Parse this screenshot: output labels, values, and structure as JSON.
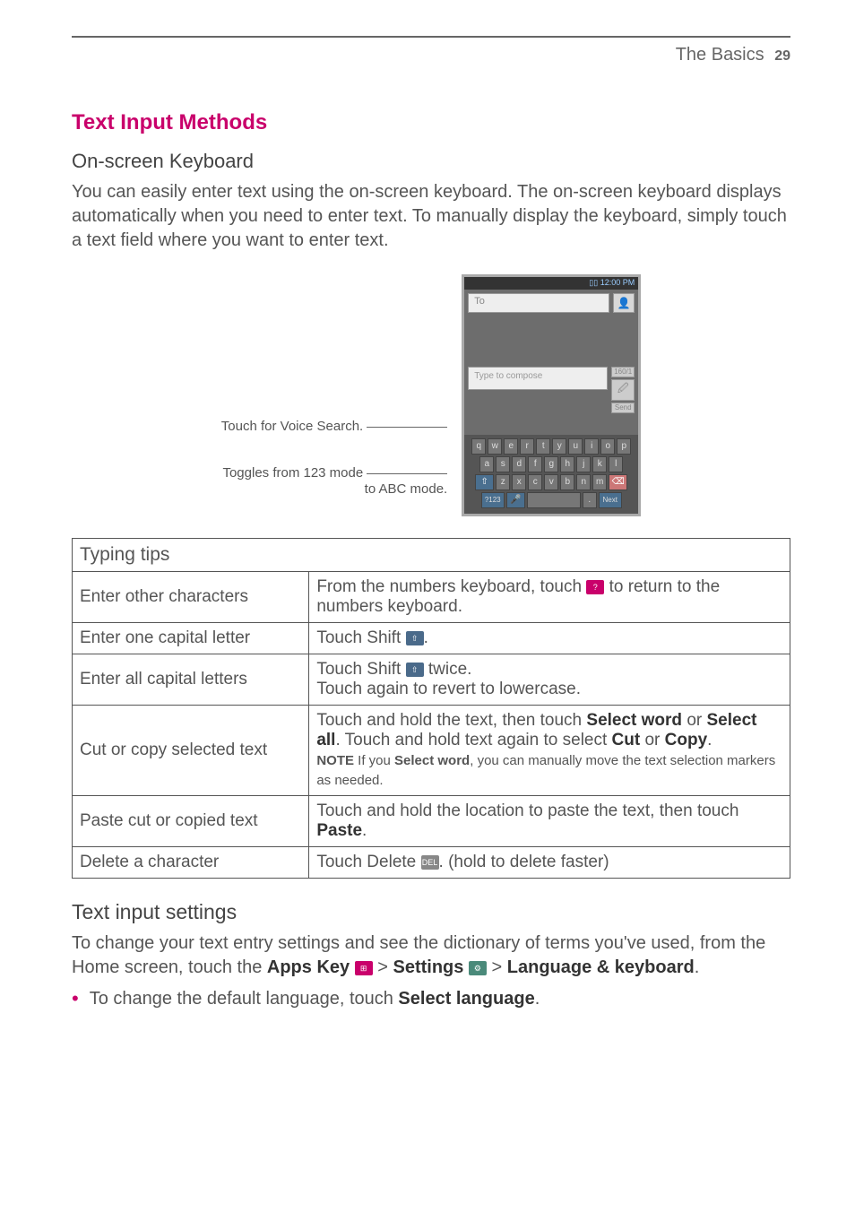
{
  "header": {
    "title": "The Basics",
    "page_num": "29"
  },
  "section": {
    "title": "Text Input Methods"
  },
  "onscreen_kb": {
    "heading": "On-screen Keyboard",
    "body": "You can easily enter text using the on-screen keyboard. The on-screen keyboard displays automatically when you need to enter text. To manually display the keyboard, simply touch a text field where you want to enter text."
  },
  "callouts": {
    "voice": "Touch for Voice Search.",
    "toggle_l1": "Toggles from 123 mode",
    "toggle_l2": "to ABC mode."
  },
  "phone": {
    "status_time": "12:00 PM",
    "to_placeholder": "To",
    "compose_placeholder": "Type to compose",
    "send_label": "Send",
    "count_label": "160/1",
    "row1": [
      "q",
      "w",
      "e",
      "r",
      "t",
      "y",
      "u",
      "i",
      "o",
      "p"
    ],
    "row2": [
      "a",
      "s",
      "d",
      "f",
      "g",
      "h",
      "j",
      "k",
      "l"
    ],
    "row3": [
      "⇧",
      "z",
      "x",
      "c",
      "v",
      "b",
      "n",
      "m",
      "⌫"
    ],
    "row4_mode": "?123",
    "row4_next": "Next"
  },
  "table": {
    "header": "Typing tips",
    "rows": {
      "r1": {
        "l": "Enter other characters",
        "r_a": "From the numbers keyboard, touch ",
        "r_b": " to return to the numbers keyboard."
      },
      "r2": {
        "l": "Enter one capital letter",
        "r_a": "Touch Shift ",
        "r_b": "."
      },
      "r3": {
        "l": "Enter all capital letters",
        "r_a": "Touch Shift ",
        "r_b": " twice.",
        "r_c": "Touch again to revert to lowercase."
      },
      "r4": {
        "l": "Cut or copy selected text",
        "r_a": "Touch and hold the text, then touch ",
        "r_b": "Select word",
        "r_c": " or ",
        "r_d": "Select all",
        "r_e": ". Touch and hold text again to select ",
        "r_f": "Cut",
        "r_g": " or ",
        "r_h": "Copy",
        "r_i": ".",
        "note_label": "NOTE",
        "note_a": " If you ",
        "note_b": "Select word",
        "note_c": ", you can manually move the text selection markers as needed."
      },
      "r5": {
        "l": "Paste cut or copied text",
        "r_a": "Touch and hold the location to paste the text, then touch ",
        "r_b": "Paste",
        "r_c": "."
      },
      "r6": {
        "l": "Delete a character",
        "r_a": "Touch Delete ",
        "r_b": ". (hold to delete faster)"
      }
    }
  },
  "settings": {
    "heading": "Text input settings",
    "body_a": "To change your text entry settings and see the dictionary of terms you've used, from the Home screen, touch the ",
    "apps_key": "Apps Key",
    "gt1": " > ",
    "settings_label": "Settings",
    "gt2": " > ",
    "lang_kb": "Language & keyboard",
    "period": ".",
    "bullet_a": "To change the default language, touch ",
    "bullet_b": "Select language",
    "bullet_c": "."
  },
  "icons": {
    "numbers_key": "?123",
    "shift": "⇧",
    "del": "DEL",
    "apps": "⊞",
    "settings": "⚙"
  }
}
